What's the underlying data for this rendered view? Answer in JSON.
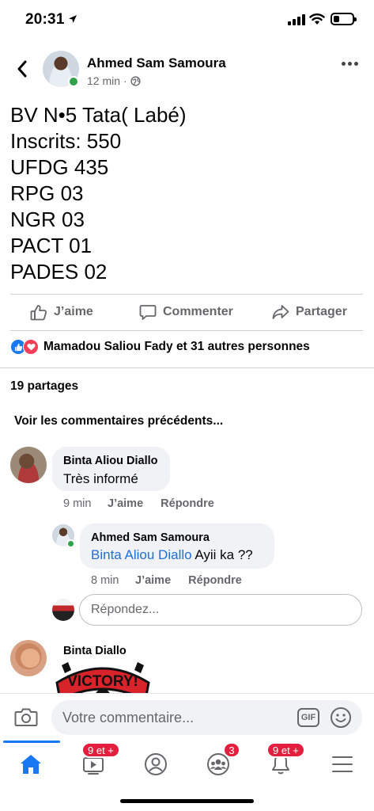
{
  "status_bar": {
    "time": "20:31",
    "battery_level": 0.3
  },
  "post": {
    "author": "Ahmed Sam Samoura",
    "time": "12 min",
    "separator": "·",
    "audience_icon": "globe-icon",
    "lines": [
      "BV N•5 Tata( Labé)",
      "Inscrits: 550",
      "UFDG 435",
      "RPG 03",
      "NGR 03",
      "PACT 01",
      "PADES 02"
    ],
    "actions": {
      "like": "J’aime",
      "comment": "Commenter",
      "share": "Partager"
    },
    "reactions_text": "Mamadou Saliou Fady et 31 autres personnes",
    "shares_text": "19 partages"
  },
  "comments": {
    "previous_label": "Voir les commentaires précédents...",
    "items": [
      {
        "name": "Binta Aliou Diallo",
        "text": "Très informé",
        "time": "9 min",
        "like": "J’aime",
        "reply": "Répondre"
      },
      {
        "name": "Ahmed Sam Samoura",
        "mention": "Binta Aliou Diallo",
        "text": " Ayii ka ??",
        "time": "8 min",
        "like": "J’aime",
        "reply": "Répondre"
      }
    ],
    "reply_placeholder": "Répondez...",
    "next_name": "Binta Diallo",
    "sticker_text": "VICTORY!"
  },
  "composer": {
    "placeholder": "Votre commentaire...",
    "gif_label": "GIF"
  },
  "tabs": {
    "home": "home-icon",
    "watch_badge": "9 et +",
    "profile": "profile-icon",
    "groups_badge": "3",
    "notifications_badge": "9 et +",
    "menu": "menu-icon"
  },
  "colors": {
    "accent": "#1877f2",
    "badge": "#e41e3f",
    "online": "#31a24c",
    "mention": "#216fdb"
  }
}
